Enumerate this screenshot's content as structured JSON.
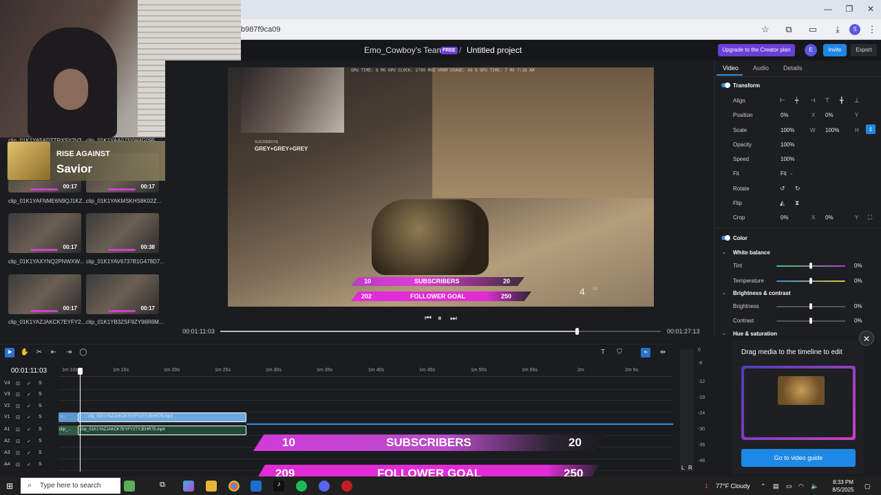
{
  "browser": {
    "url_fragment": "b987f9ca09",
    "icons": [
      "star-icon",
      "extensions-icon",
      "cast-icon",
      "download-icon",
      "profile-icon",
      "menu-icon"
    ],
    "profile_initial": "S",
    "window": {
      "minimize": "—",
      "restore": "❐",
      "close": "✕"
    }
  },
  "header": {
    "team": "Emo_Cowboy's Team",
    "badge": "FREE",
    "separator": "/",
    "project": "Untitled project",
    "upgrade_label": "Upgrade to the Creator plan",
    "avatar_initial": "E",
    "invite_label": "Invite",
    "export_label": "Export"
  },
  "media": {
    "now_playing": {
      "band": "RISE AGAINST",
      "song": "Savior"
    },
    "clips": [
      {
        "label": "clip_01K1YA5ADTTRXSY2V3...",
        "duration": ""
      },
      {
        "label": "clip_01K1YAA0J3YW4G095...",
        "duration": ""
      },
      {
        "label": "clip_01K1YAFNME6N9QJ1KZ...",
        "duration": "00:17"
      },
      {
        "label": "clip_01K1YAKMSKHS8K02Z...",
        "duration": "00:17"
      },
      {
        "label": "clip_01K1YAXYNQ2PNWXW...",
        "duration": "00:17"
      },
      {
        "label": "clip_01K1YAV6737B1G478D7...",
        "duration": "00:38"
      },
      {
        "label": "clip_01K1YAZJAKCK7EYFY2...",
        "duration": "00:17"
      },
      {
        "label": "clip_01K1YB3ZSF9ZY96R6M...",
        "duration": "00:17"
      }
    ]
  },
  "preview": {
    "hud_text": "GPU TIME: 6 MS  GPU CLOCK: 2790 MHZ  VRAM USAGE: 40 %  GPU TIME: 7 MS  7:16 AM",
    "killfeed_tag": "SUICIDEBOY$",
    "killfeed_name": "GREY+GREY+GREY",
    "banner1": {
      "left": "10",
      "center": "SUBSCRIBERS",
      "right": "20"
    },
    "banner2": {
      "left": "202",
      "center": "FOLLOWER GOAL",
      "right": "250"
    },
    "ammo": "4",
    "ammo_reserve": "15",
    "current_time": "00:01:11:03",
    "total_time": "00:01:27:13",
    "progress": 0.81
  },
  "panel": {
    "tabs": [
      "Video",
      "Audio",
      "Details"
    ],
    "transform_title": "Transform",
    "align_label": "Align",
    "position": {
      "label": "Position",
      "x": "0%",
      "x_axis": "X",
      "y": "0%",
      "y_axis": "Y"
    },
    "scale": {
      "label": "Scale",
      "w": "100%",
      "w_axis": "W",
      "h": "100%",
      "h_axis": "H"
    },
    "opacity": {
      "label": "Opacity",
      "value": "100%"
    },
    "speed": {
      "label": "Speed",
      "value": "100%"
    },
    "fit": {
      "label": "Fit",
      "value": "Fit"
    },
    "rotate_label": "Rotate",
    "flip_label": "Flip",
    "crop": {
      "label": "Crop",
      "x": "0%",
      "x_axis": "X",
      "y": "0%",
      "y_axis": "Y"
    },
    "color_title": "Color",
    "white_balance": "White balance",
    "tint": {
      "label": "Tint",
      "value": "0%",
      "level": 0.5
    },
    "temperature": {
      "label": "Temperature",
      "value": "0%",
      "level": 0.5
    },
    "brightness_contrast": "Brightness & contrast",
    "brightness": {
      "label": "Brightness",
      "value": "0%",
      "level": 0.5
    },
    "contrast": {
      "label": "Contrast",
      "value": "0%",
      "level": 0.5
    },
    "hue_saturation": "Hue & saturation"
  },
  "timeline": {
    "current_time": "00:01:11:03",
    "ticks": [
      "1m 10s",
      "1m 15s",
      "1m 20s",
      "1m 25s",
      "1m 30s",
      "1m 35s",
      "1m 40s",
      "1m 45s",
      "1m 50s",
      "1m 55s",
      "2m",
      "2m 5s"
    ],
    "tracks": [
      "V4",
      "V3",
      "V2",
      "V1",
      "A1",
      "A2",
      "A3",
      "A4"
    ],
    "track_s": "S",
    "clip_v1_short": "c...",
    "clip_v1": "clip_01K1YAZJAKCK7EYFY2TYJEHR79.mp4",
    "clip_a1_short": "clip_...",
    "clip_a1": "clip_01K1YAZJAKCK7EYFY2TYJEHR79.mp4",
    "meter_labels": [
      "0",
      "-6",
      "-12",
      "-18",
      "-24",
      "-30",
      "-36",
      "-48"
    ],
    "meter_lr": {
      "l": "L",
      "r": "R"
    }
  },
  "overlay": {
    "banner1": {
      "left": "10",
      "center": "SUBSCRIBERS",
      "right": "20"
    },
    "banner2": {
      "left": "209",
      "center": "FOLLOWER GOAL",
      "right": "250"
    }
  },
  "guide": {
    "title": "Drag media to the timeline to edit",
    "button": "Go to video guide",
    "close": "✕"
  },
  "taskbar": {
    "search_placeholder": "Type here to search",
    "weather": "77°F  Cloudy",
    "time": "8:33 PM",
    "date": "8/5/2025",
    "notification_count": "1"
  }
}
